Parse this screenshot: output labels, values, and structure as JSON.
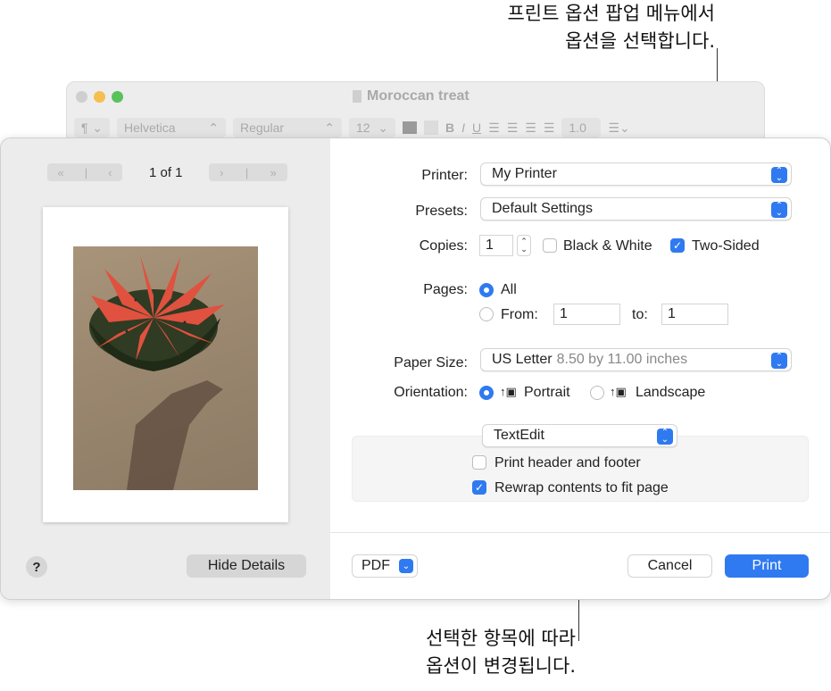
{
  "callouts": {
    "top_line1": "프린트 옵션 팝업 메뉴에서",
    "top_line2": "옵션을 선택합니다.",
    "bottom_line1": "선택한 항목에 따라",
    "bottom_line2": "옵션이 변경됩니다."
  },
  "background_window": {
    "title": "Moroccan treat",
    "toolbar": {
      "paragraph": "¶",
      "font": "Helvetica",
      "style": "Regular",
      "size": "12",
      "line_spacing": "1.0"
    }
  },
  "preview": {
    "page_count": "1 of 1",
    "first_icon": "«",
    "prev_icon": "‹",
    "next_icon": "›",
    "last_icon": "»"
  },
  "form": {
    "printer_label": "Printer:",
    "printer_value": "My Printer",
    "presets_label": "Presets:",
    "presets_value": "Default Settings",
    "copies_label": "Copies:",
    "copies_value": "1",
    "bw_label": "Black & White",
    "two_sided_label": "Two-Sided",
    "pages_label": "Pages:",
    "all_label": "All",
    "from_label": "From:",
    "from_value": "1",
    "to_label": "to:",
    "to_value": "1",
    "paper_size_label": "Paper Size:",
    "paper_size_value": "US Letter",
    "paper_size_detail": "8.50 by 11.00 inches",
    "orientation_label": "Orientation:",
    "portrait_label": "Portrait",
    "landscape_label": "Landscape",
    "app_options_value": "TextEdit",
    "header_footer_label": "Print header and footer",
    "rewrap_label": "Rewrap contents to fit page"
  },
  "state": {
    "black_white": false,
    "two_sided": true,
    "pages_all": true,
    "orientation": "portrait",
    "header_footer": false,
    "rewrap": true
  },
  "footer": {
    "help": "?",
    "hide_details": "Hide Details",
    "pdf": "PDF",
    "cancel": "Cancel",
    "print": "Print"
  },
  "colors": {
    "accent": "#2f7af0"
  }
}
